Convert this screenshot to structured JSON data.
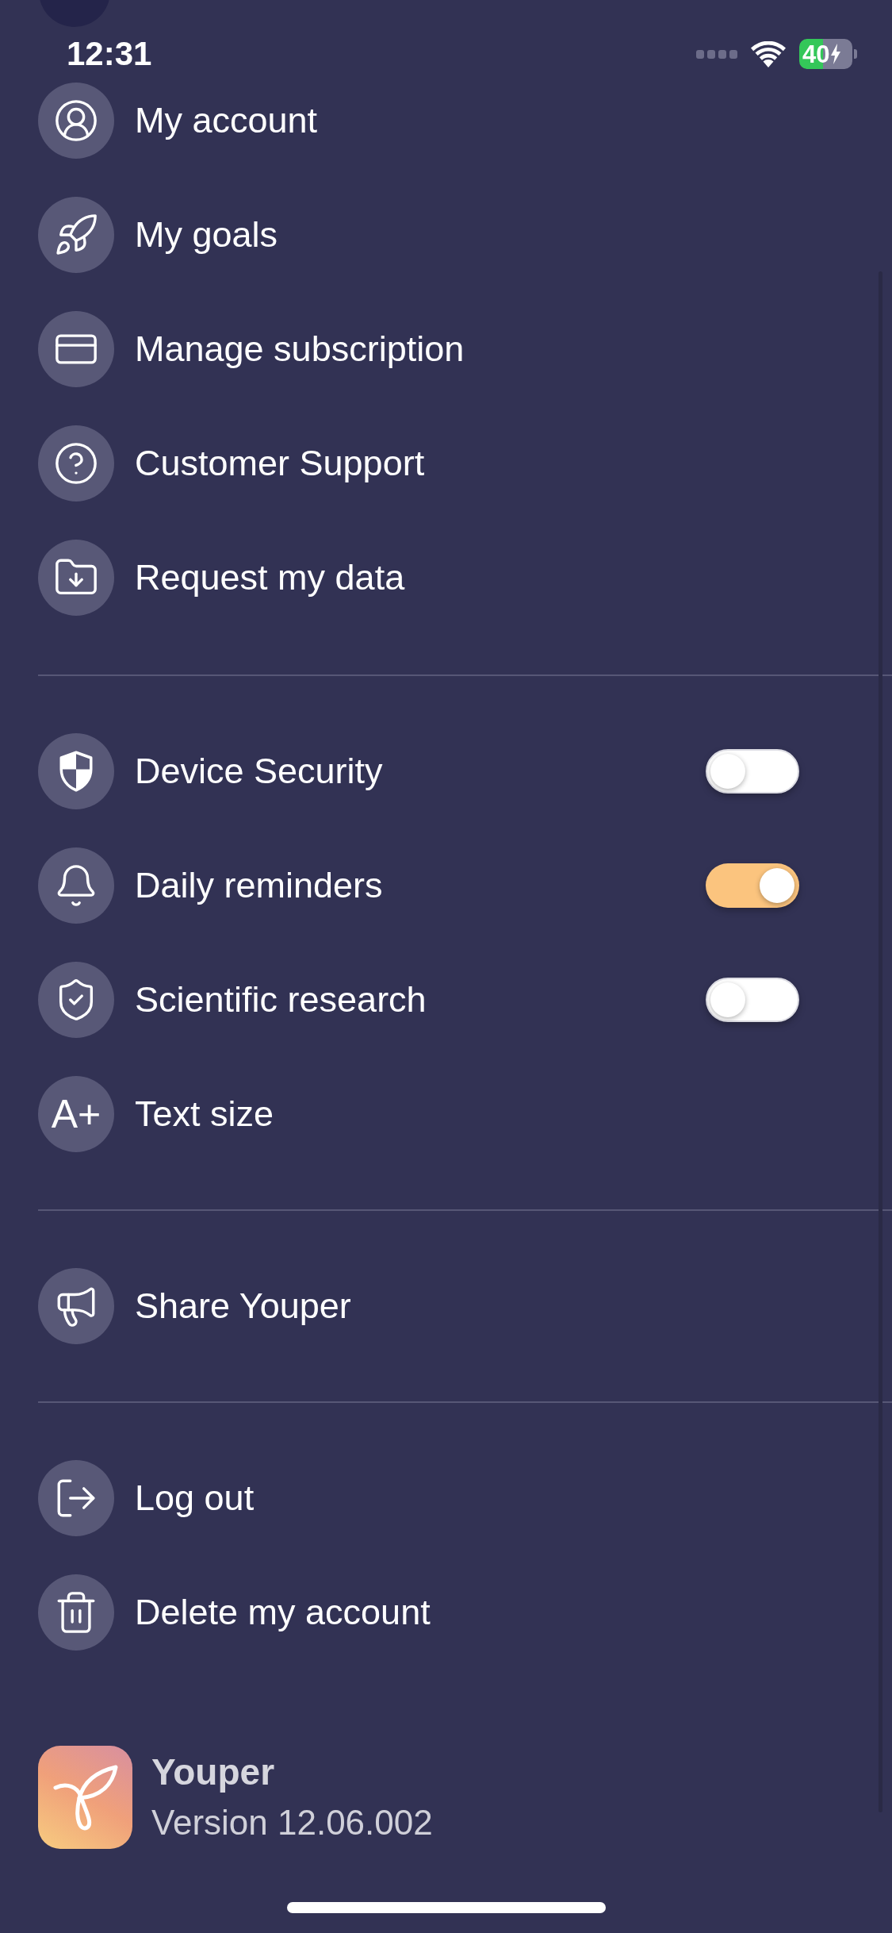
{
  "status_bar": {
    "time": "12:31",
    "battery": "40"
  },
  "sections": [
    {
      "items": [
        {
          "kind": "link",
          "label": "My account"
        },
        {
          "kind": "link",
          "label": "My goals"
        },
        {
          "kind": "link",
          "label": "Manage subscription"
        },
        {
          "kind": "link",
          "label": "Customer Support"
        },
        {
          "kind": "link",
          "label": "Request my data"
        }
      ]
    },
    {
      "items": [
        {
          "kind": "toggle",
          "label": "Device Security",
          "on": false
        },
        {
          "kind": "toggle",
          "label": "Daily reminders",
          "on": true
        },
        {
          "kind": "toggle",
          "label": "Scientific research",
          "on": false
        },
        {
          "kind": "link",
          "label": "Text size",
          "glyph": "A+"
        }
      ]
    },
    {
      "items": [
        {
          "kind": "link",
          "label": "Share Youper"
        }
      ]
    },
    {
      "items": [
        {
          "kind": "link",
          "label": "Log out"
        },
        {
          "kind": "link",
          "label": "Delete my account"
        }
      ]
    }
  ],
  "app": {
    "name": "Youper",
    "version": "Version 12.06.002"
  }
}
